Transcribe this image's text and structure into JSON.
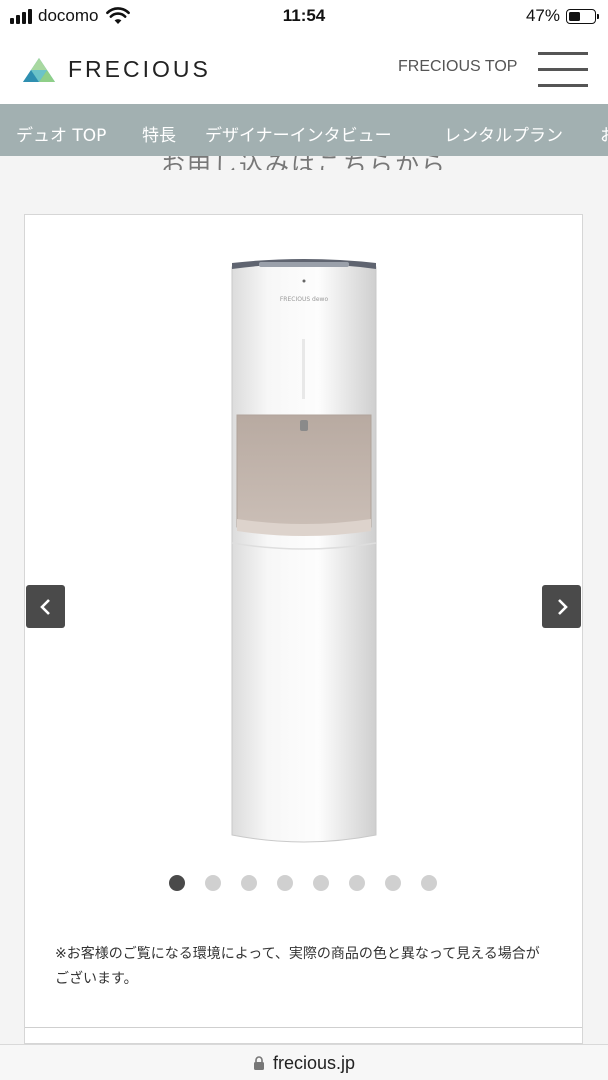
{
  "status_bar": {
    "carrier": "docomo",
    "time": "11:54",
    "battery_percent": "47%",
    "battery_level": 0.47,
    "icons": [
      "signal-icon",
      "wifi-icon",
      "battery-icon"
    ]
  },
  "header": {
    "logo_text": "FRECIOUS",
    "top_link": "FRECIOUS TOP",
    "menu_icon": "hamburger-menu-icon"
  },
  "nav": {
    "items": [
      "デュオ TOP",
      "特長",
      "デザイナーインタビュー",
      "レンタルプラン",
      "お"
    ]
  },
  "section": {
    "partial_heading": "お申し込みはこちらから"
  },
  "carousel": {
    "product_label": "FRECIOUS dewo",
    "prev_icon": "chevron-left-icon",
    "next_icon": "chevron-right-icon",
    "slide_count": 8,
    "active_index": 0,
    "note": "※お客様のご覧になる環境によって、実際の商品の色と異なって見える場合がございます。"
  },
  "browser": {
    "url": "frecious.jp",
    "lock_icon": "lock-icon"
  },
  "colors": {
    "nav_bg": "#a2b0b1",
    "arrow_bg": "#4a4a4a",
    "dispense_area": "#c2b5ac"
  }
}
